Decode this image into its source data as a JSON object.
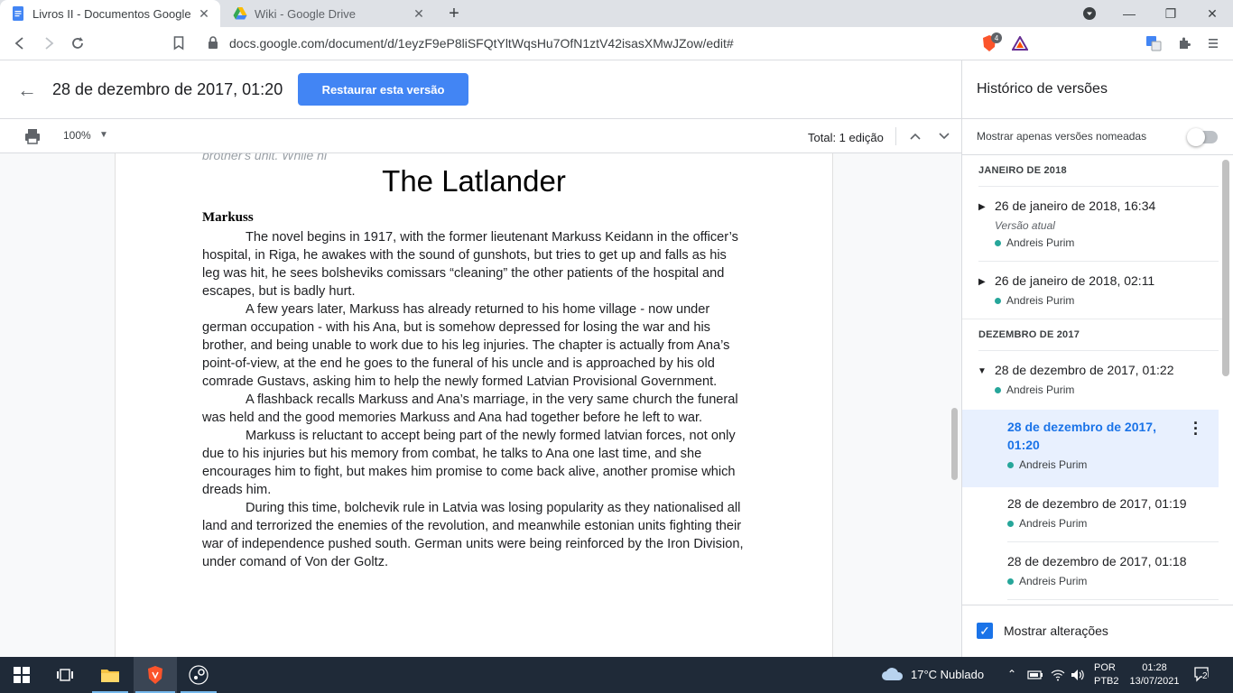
{
  "browser": {
    "tabs": [
      {
        "title": "Livros II - Documentos Google",
        "close": "✕",
        "active": true
      },
      {
        "title": "Wiki - Google Drive",
        "close": "✕",
        "active": false
      }
    ],
    "new_tab": "+",
    "url": "docs.google.com/document/d/1eyzF9eP8liSFQtYltWqsHu7OfN1ztV42isasXMwJZow/edit#",
    "window_controls": {
      "minimize": "—",
      "restore": "❐",
      "close": "✕"
    },
    "extension_badge": "4"
  },
  "doc_header": {
    "back_icon": "←",
    "version_title": "28 de dezembro de 2017, 01:20",
    "restore_label": "Restaurar esta versão"
  },
  "doc_toolbar": {
    "zoom": "100%",
    "total": "Total: 1 edição"
  },
  "document": {
    "cut_text": "brother's unit. While hi",
    "title": "The Latlander",
    "heading": "Markuss",
    "paragraphs": [
      "The novel begins in 1917, with the former lieutenant Markuss Keidann in the officer’s hospital, in Riga, he awakes with the sound of gunshots, but tries to get up and falls as his leg was hit, he sees bolsheviks comissars “cleaning” the other patients of the hospital and escapes, but is badly hurt.",
      "A few years later, Markuss has already returned to his home village - now under german occupation - with his Ana, but is somehow depressed for losing the war and his brother, and being unable to work due to his leg injuries. The chapter is actually from Ana’s point-of-view, at the end he goes to the funeral of his uncle and is approached by his old comrade Gustavs, asking him to help the newly formed Latvian Provisional Government.",
      "A flashback recalls Markuss and Ana’s marriage, in the very same church the funeral was held and the good memories Markuss and Ana had together before he left to war.",
      "Markuss is reluctant to accept being part of the newly formed latvian forces, not only due to his injuries but his memory from combat, he talks to Ana one last time, and she encourages him to fight, but makes him promise to come back alive, another promise which dreads him.",
      "During this time, bolchevik rule in Latvia was losing popularity as they nationalised all land and terrorized the enemies of the revolution, and meanwhile estonian units fighting their war of independence pushed south. German units were being reinforced by the Iron Division, under comand of Von der Goltz."
    ]
  },
  "history": {
    "title": "Histórico de versões",
    "named_only_label": "Mostrar apenas versões nomeadas",
    "named_only_on": false,
    "months": [
      "JANEIRO DE 2018",
      "DEZEMBRO DE 2017"
    ],
    "entries": [
      {
        "date": "26 de janeiro de 2018, 16:34",
        "current": "Versão atual",
        "author": "Andreis Purim"
      },
      {
        "date": "26 de janeiro de 2018, 02:11",
        "author": "Andreis Purim"
      },
      {
        "date": "28 de dezembro de 2017, 01:22",
        "author": "Andreis Purim"
      },
      {
        "date_line1": "28 de dezembro de 2017,",
        "date_line2": "01:20",
        "author": "Andreis Purim"
      },
      {
        "date": "28 de dezembro de 2017, 01:19",
        "author": "Andreis Purim"
      },
      {
        "date": "28 de dezembro de 2017, 01:18",
        "author": "Andreis Purim"
      }
    ],
    "show_changes_label": "Mostrar alterações",
    "show_changes_checked": true,
    "author_color": "#26a69a"
  },
  "taskbar": {
    "weather": "17°C  Nublado",
    "lang_line1": "POR",
    "lang_line2": "PTB2",
    "time": "01:28",
    "date": "13/07/2021",
    "notifications": "2"
  }
}
